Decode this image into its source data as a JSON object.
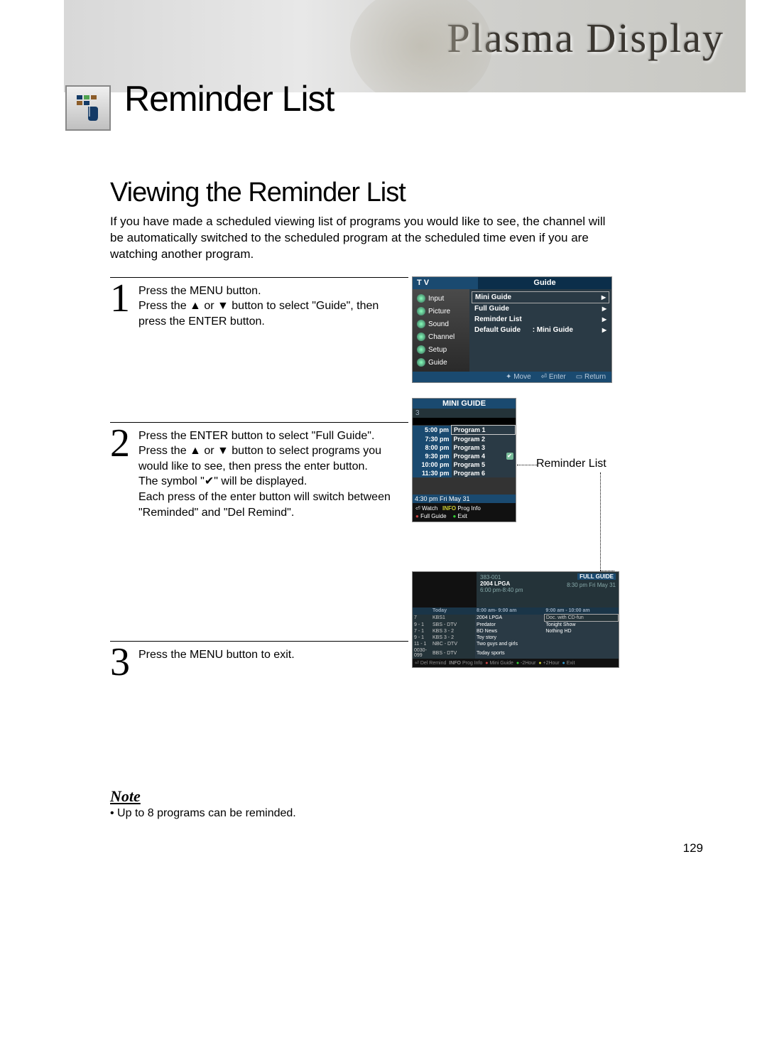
{
  "header": {
    "product_line": "Plasma Display",
    "chapter_title": "Reminder List"
  },
  "section": {
    "heading": "Viewing the Reminder List",
    "intro": "If you have made a scheduled viewing list of programs you would like to see, the channel will be automatically switched to the scheduled program at the scheduled time even if you are watching another program."
  },
  "steps": [
    {
      "num": "1",
      "lines": [
        "Press the MENU button.",
        "Press the ▲ or ▼ button to select \"Guide\", then press the ENTER button."
      ]
    },
    {
      "num": "2",
      "lines": [
        "Press the ENTER button to select \"Full Guide\".",
        "Press the ▲ or ▼ button to select programs you would like to see, then press the enter button.",
        "The symbol \"✔\" will be displayed.",
        "Each press of the enter button will switch between \"Reminded\" and \"Del Remind\"."
      ]
    },
    {
      "num": "3",
      "lines": [
        "Press the MENU button to exit."
      ]
    }
  ],
  "note": {
    "heading": "Note",
    "bullet": "• Up to 8 programs can be reminded."
  },
  "osd1": {
    "tv_label": "T V",
    "guide_label": "Guide",
    "left_items": [
      "Input",
      "Picture",
      "Sound",
      "Channel",
      "Setup",
      "Guide"
    ],
    "right_items": [
      {
        "label": "Mini Guide",
        "extra": ""
      },
      {
        "label": "Full Guide",
        "extra": ""
      },
      {
        "label": "Reminder List",
        "extra": ""
      },
      {
        "label": "Default Guide",
        "extra": ": Mini Guide"
      }
    ],
    "footer": [
      "Move",
      "Enter",
      "Return"
    ]
  },
  "osd2": {
    "title": "MINI GUIDE",
    "channel": "3",
    "programs": [
      {
        "time": "5:00 pm",
        "name": "Program 1",
        "sel": true
      },
      {
        "time": "7:30 pm",
        "name": "Program 2"
      },
      {
        "time": "8:00 pm",
        "name": "Program 3"
      },
      {
        "time": "9:30 pm",
        "name": "Program 4",
        "check": true
      },
      {
        "time": "10:00 pm",
        "name": "Program 5"
      },
      {
        "time": "11:30 pm",
        "name": "Program 6"
      }
    ],
    "clock": "4:30 pm  Fri May 31",
    "footer": {
      "watch": "Watch",
      "info": "INFO",
      "proginfo": "Prog Info",
      "full": "Full Guide",
      "exit": "Exit"
    },
    "annotation": "Reminder List"
  },
  "osd3": {
    "full_guide_label": "FULL GUIDE",
    "datetime": "8:30 pm Fri May 31",
    "channel": "383-001",
    "prog_title": "2004 LPGA",
    "prog_time": "6:00 pm-8:40 pm",
    "cols": [
      "",
      "Today",
      "8:00 am- 9:00 am",
      "9:00 am - 10:00 am"
    ],
    "rows": [
      [
        "7",
        "KBS1",
        "2004 LPGA",
        "Doc. with CD-fun"
      ],
      [
        "9 - 1",
        "SBS - DTV",
        "Predator",
        "Tonight Show"
      ],
      [
        "7 - 1",
        "KBS 3 - 2",
        "BD News",
        "Nothing HD"
      ],
      [
        "9 - 1",
        "KBS 3 - 2",
        "Toy story",
        ""
      ],
      [
        "11 - 1",
        "NBC - DTV",
        "Two guys and girls",
        ""
      ],
      [
        "0030-099",
        "BBS - DTV",
        "Today sports",
        ""
      ]
    ],
    "foot": [
      "Del Remind",
      "INFO",
      "Prog Info",
      "Mini Guide",
      "-2Hour",
      "+2Hour",
      "Exit"
    ]
  },
  "page_number": "129"
}
